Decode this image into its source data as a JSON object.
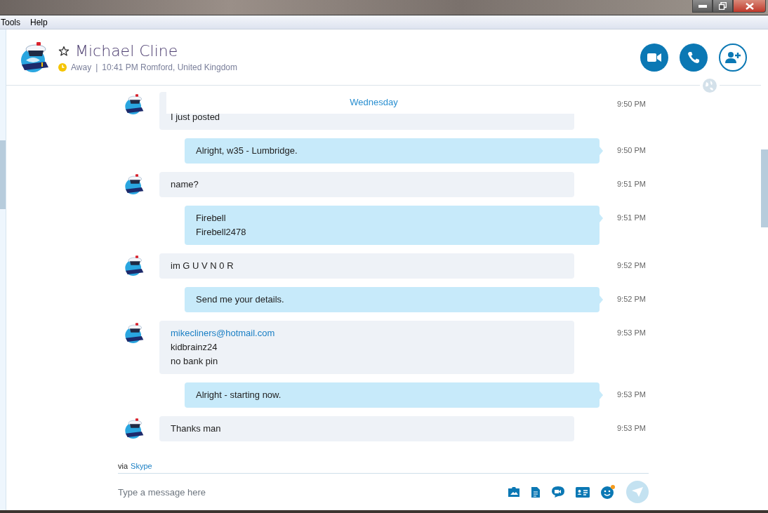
{
  "menu": [
    {
      "label": "Tools"
    },
    {
      "label": "Help"
    }
  ],
  "contact": {
    "name": "Michael Cline",
    "favorite": false,
    "presence": {
      "kind": "away",
      "text": "Away"
    },
    "separator": "|",
    "local_info": "10:41 PM Romford, United Kingdom"
  },
  "date_divider": "Wednesday",
  "messages": [
    {
      "kind": "incoming",
      "lines": [
        {
          "kind": "text",
          "text": "I just posted"
        }
      ],
      "time": "9:50 PM"
    },
    {
      "kind": "outgoing",
      "lines": [
        {
          "kind": "text",
          "text": "Alright, w35 - Lumbridge."
        }
      ],
      "time": "9:50 PM"
    },
    {
      "kind": "incoming",
      "lines": [
        {
          "kind": "text",
          "text": "name?"
        }
      ],
      "time": "9:51 PM"
    },
    {
      "kind": "outgoing",
      "lines": [
        {
          "kind": "text",
          "text": "Firebell"
        },
        {
          "kind": "text",
          "text": "Firebell2478"
        }
      ],
      "time": "9:51 PM"
    },
    {
      "kind": "incoming",
      "lines": [
        {
          "kind": "text",
          "text": "im G U V N 0 R"
        }
      ],
      "time": "9:52 PM"
    },
    {
      "kind": "outgoing",
      "lines": [
        {
          "kind": "text",
          "text": "Send me your details."
        }
      ],
      "time": "9:52 PM"
    },
    {
      "kind": "incoming",
      "lines": [
        {
          "kind": "link",
          "text": "mikecliners@hotmail.com"
        },
        {
          "kind": "text",
          "text": "kidbrainz24"
        },
        {
          "kind": "text",
          "text": "no bank pin"
        }
      ],
      "time": "9:53 PM"
    },
    {
      "kind": "outgoing",
      "lines": [
        {
          "kind": "text",
          "text": "Alright - starting now."
        }
      ],
      "time": "9:53 PM"
    },
    {
      "kind": "incoming",
      "lines": [
        {
          "kind": "text",
          "text": "Thanks man"
        }
      ],
      "time": "9:53 PM"
    }
  ],
  "footer": {
    "via": "via",
    "network": "Skype",
    "placeholder": "Type a message here"
  }
}
